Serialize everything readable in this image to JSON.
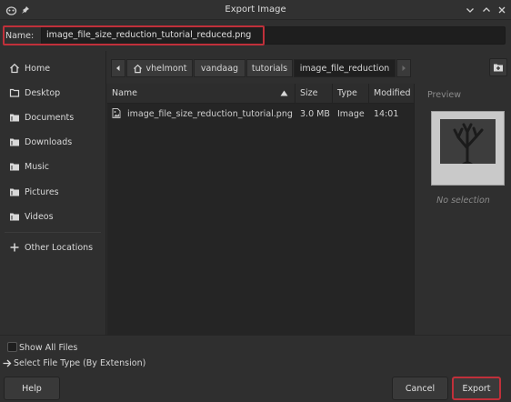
{
  "window": {
    "title": "Export Image"
  },
  "name_field": {
    "label": "Name:",
    "value": "image_file_size_reduction_tutorial_reduced.png"
  },
  "sidebar": {
    "items": [
      {
        "label": "Home",
        "icon": "home-icon"
      },
      {
        "label": "Desktop",
        "icon": "desktop-icon"
      },
      {
        "label": "Documents",
        "icon": "folder-icon"
      },
      {
        "label": "Downloads",
        "icon": "folder-icon"
      },
      {
        "label": "Music",
        "icon": "folder-icon"
      },
      {
        "label": "Pictures",
        "icon": "folder-icon"
      },
      {
        "label": "Videos",
        "icon": "folder-icon"
      },
      {
        "label": "Other Locations",
        "icon": "plus-icon"
      }
    ]
  },
  "pathbar": {
    "crumbs": [
      "vhelmont",
      "vandaag",
      "tutorials",
      "image_file_reduction"
    ]
  },
  "filelist": {
    "headers": {
      "name": "Name",
      "size": "Size",
      "type": "Type",
      "modified": "Modified"
    },
    "rows": [
      {
        "name": "image_file_size_reduction_tutorial.png",
        "size": "3.0 MB",
        "type": "Image",
        "modified": "14:01"
      }
    ]
  },
  "preview": {
    "header": "Preview",
    "empty_text": "No selection"
  },
  "options": {
    "show_all_files": "Show All Files",
    "show_all_checked": false,
    "file_type": "Select File Type (By Extension)"
  },
  "buttons": {
    "help": "Help",
    "cancel": "Cancel",
    "export": "Export"
  },
  "colors": {
    "highlight_border": "#c0303a",
    "background": "#2f2f2f",
    "list_background": "#252525"
  }
}
